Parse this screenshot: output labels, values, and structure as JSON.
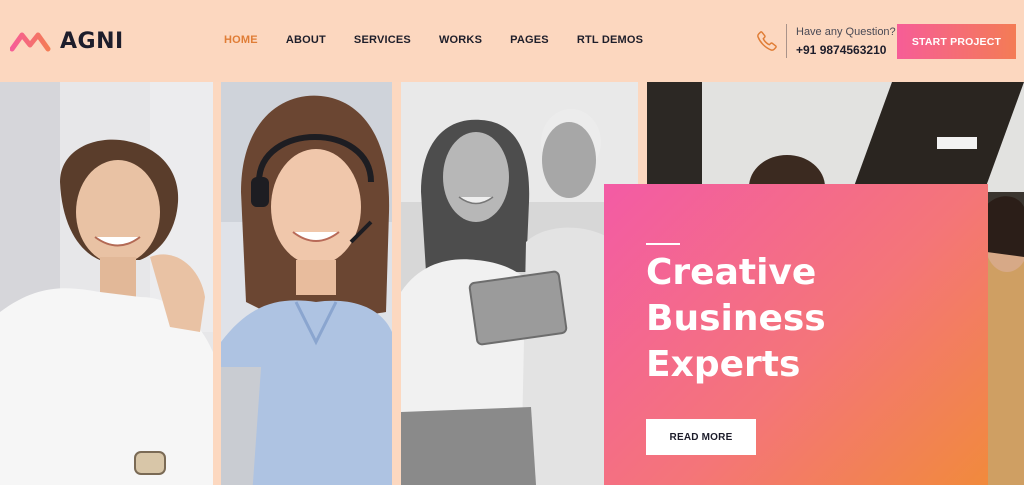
{
  "brand": {
    "name": "AGNI",
    "accent": "#e07d36",
    "gradient_start": "#f65d97",
    "gradient_end": "#f47c55"
  },
  "nav": {
    "items": [
      {
        "label": "HOME",
        "active": true
      },
      {
        "label": "ABOUT"
      },
      {
        "label": "SERVICES"
      },
      {
        "label": "WORKS"
      },
      {
        "label": "PAGES"
      },
      {
        "label": "RTL DEMOS"
      }
    ]
  },
  "contact": {
    "question": "Have any Question?",
    "phone": "+91 9874563210",
    "icon": "phone-icon"
  },
  "cta": {
    "label": "START PROJECT"
  },
  "hero": {
    "title": "Creative\nBusiness\nExperts",
    "button_label": "READ MORE"
  },
  "photos": [
    {
      "name": "photo-smiling-woman"
    },
    {
      "name": "photo-headset-agent"
    },
    {
      "name": "photo-colleagues-tablet"
    },
    {
      "name": "photo-team-meeting"
    }
  ]
}
